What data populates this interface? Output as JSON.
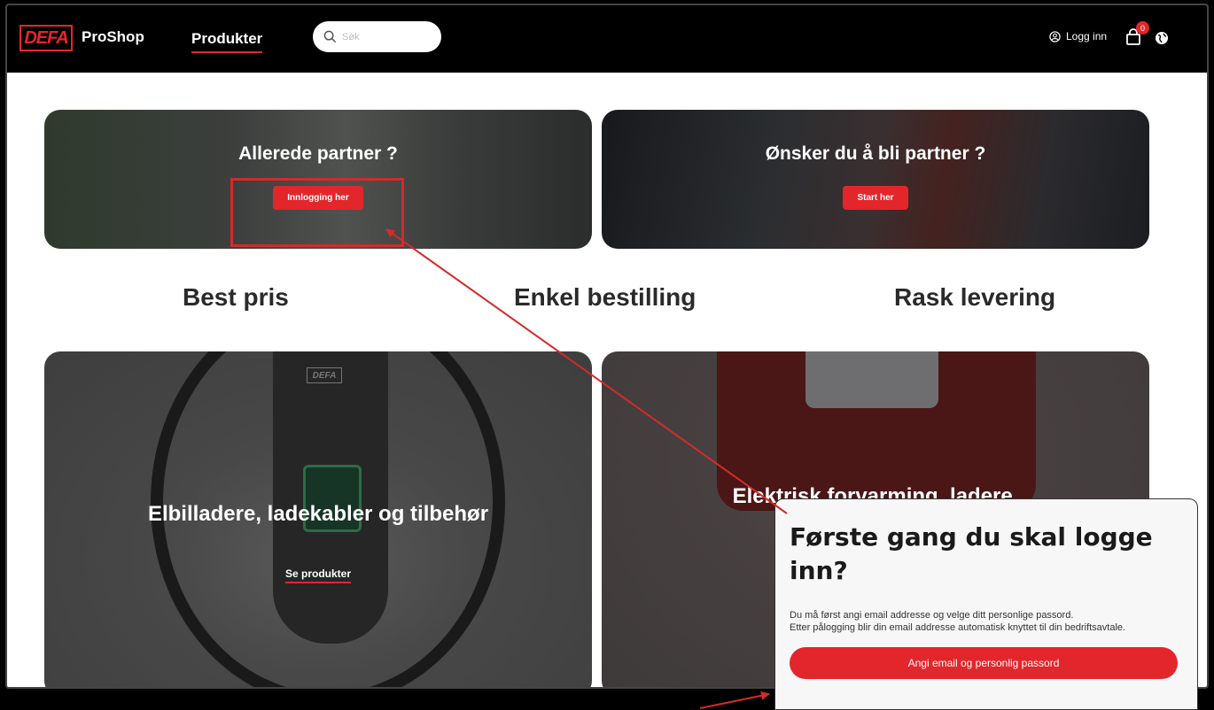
{
  "header": {
    "logo_text": "DEFA",
    "brand": "ProShop",
    "nav_products": "Produkter",
    "search_placeholder": "Søk",
    "login_label": "Logg inn",
    "cart_count": "0"
  },
  "hero": {
    "left": {
      "title": "Allerede partner ?",
      "button": "Innlogging her"
    },
    "right": {
      "title": "Ønsker du å bli partner ?",
      "button": "Start her"
    }
  },
  "features": [
    "Best pris",
    "Enkel bestilling",
    "Rask levering"
  ],
  "cards": {
    "left": {
      "title": "Elbilladere, ladekabler og tilbehør",
      "link": "Se produkter",
      "device_logo": "DEFA"
    },
    "right": {
      "title": "Elektrisk forvarming, ladere,"
    }
  },
  "popup": {
    "title": "Første gang du skal logge inn?",
    "line1": "Du må først angi email addresse og velge ditt personlige passord.",
    "line2": "Etter pålogging blir din email addresse automatisk knyttet til din bedriftsavtale.",
    "button": "Angi email og personlig passord"
  },
  "colors": {
    "accent": "#e3262b",
    "annotation": "#d42a2a"
  }
}
